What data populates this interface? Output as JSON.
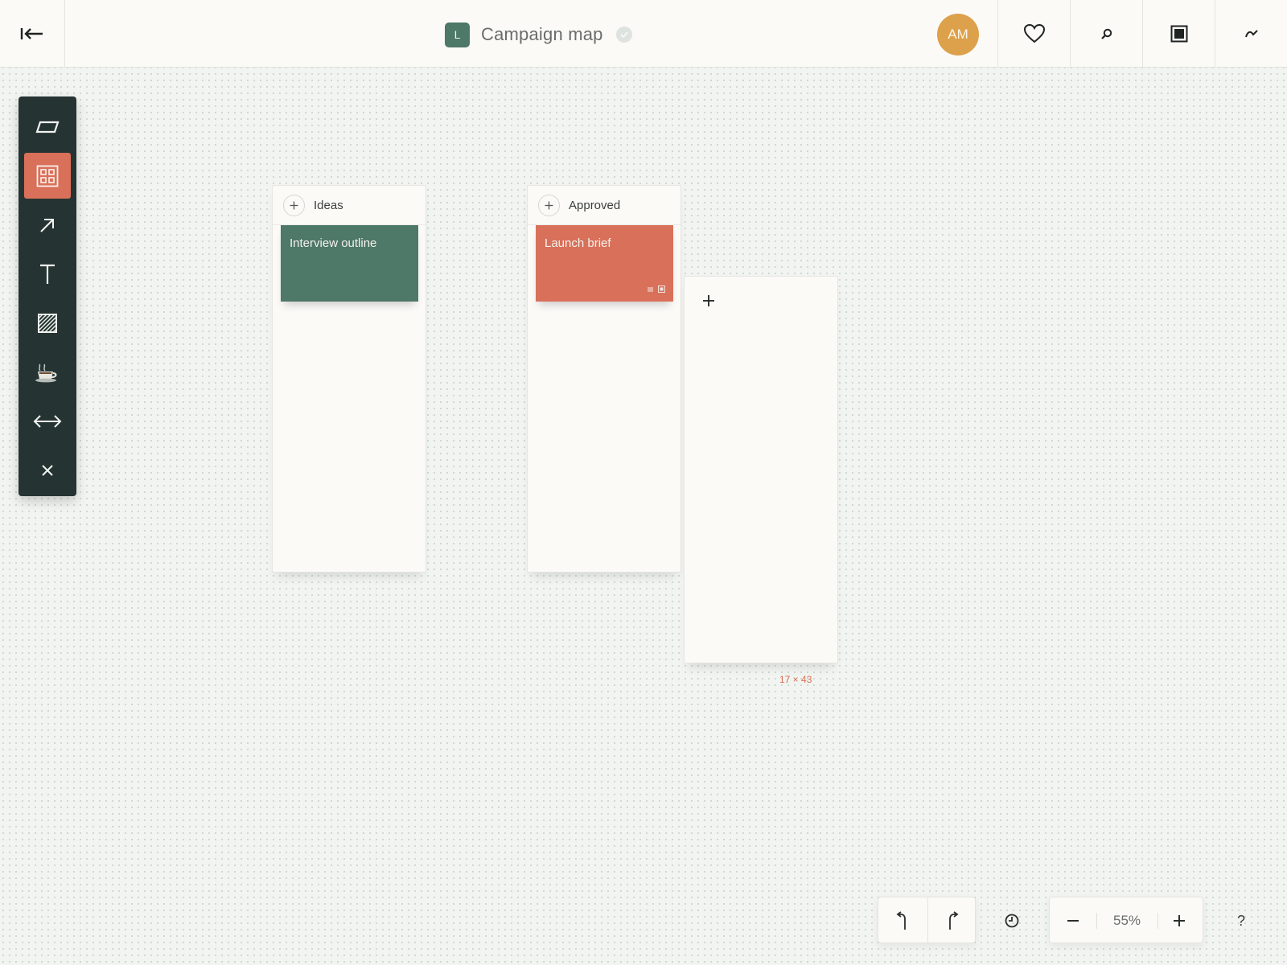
{
  "header": {
    "logo_letter": "L",
    "title": "Campaign map",
    "user_initials": "AM",
    "avatar_color": "#dca14a",
    "actions": [
      "heart-icon",
      "search-icon",
      "present-icon",
      "share-icon"
    ]
  },
  "toolbar": {
    "accent": "#253432",
    "active_color": "#d9705a",
    "tools": [
      "frame-icon",
      "board-grid-icon",
      "arrow-icon",
      "text-icon",
      "hatch-fill-icon",
      "coffee-cup-icon",
      "width-resize-icon",
      "close-icon"
    ],
    "active_tool": "board-grid-icon"
  },
  "board": {
    "columns": [
      {
        "title": "Ideas",
        "cards": [
          {
            "title": "Interview outline",
            "color": "#4e7868"
          }
        ]
      },
      {
        "title": "Approved",
        "cards": [
          {
            "title": "Launch brief",
            "color": "#d9705a"
          }
        ]
      }
    ],
    "new_column_size": "17 × 43"
  },
  "controls": {
    "zoom": "55%",
    "help": "?"
  }
}
